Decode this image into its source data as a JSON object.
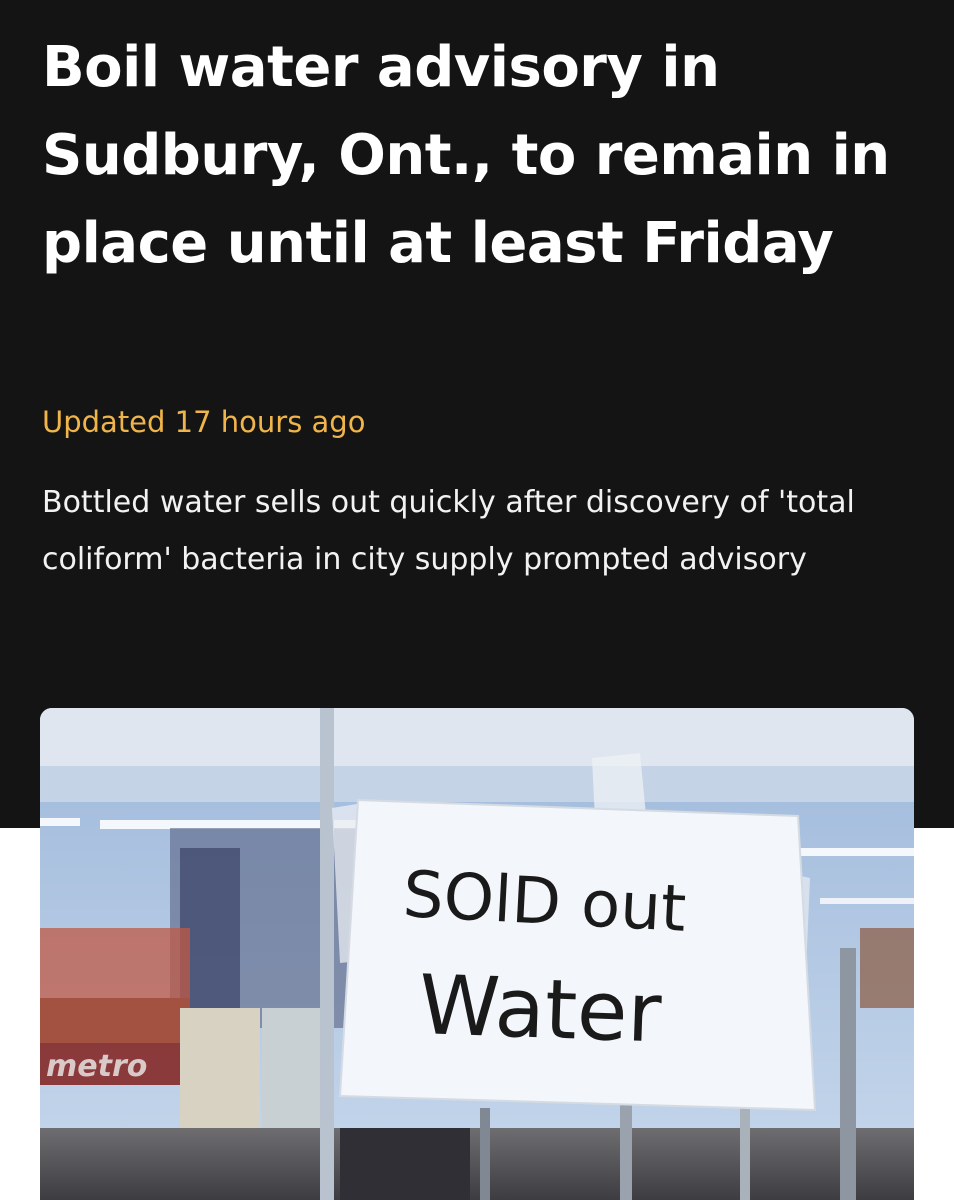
{
  "article": {
    "headline": "Boil water advisory in Sudbury, Ont., to remain in place until at least Friday",
    "updated": "Updated 17 hours ago",
    "dek": "Bottled water sells out quickly after discovery of 'total coliform' bacteria in city supply prompted advisory"
  },
  "photo": {
    "sign_line1": "SOlD out",
    "sign_line2": "Water",
    "store_logo": "metro"
  },
  "colors": {
    "header_bg": "#141414",
    "timestamp": "#f0b54a",
    "text": "#ffffff"
  }
}
